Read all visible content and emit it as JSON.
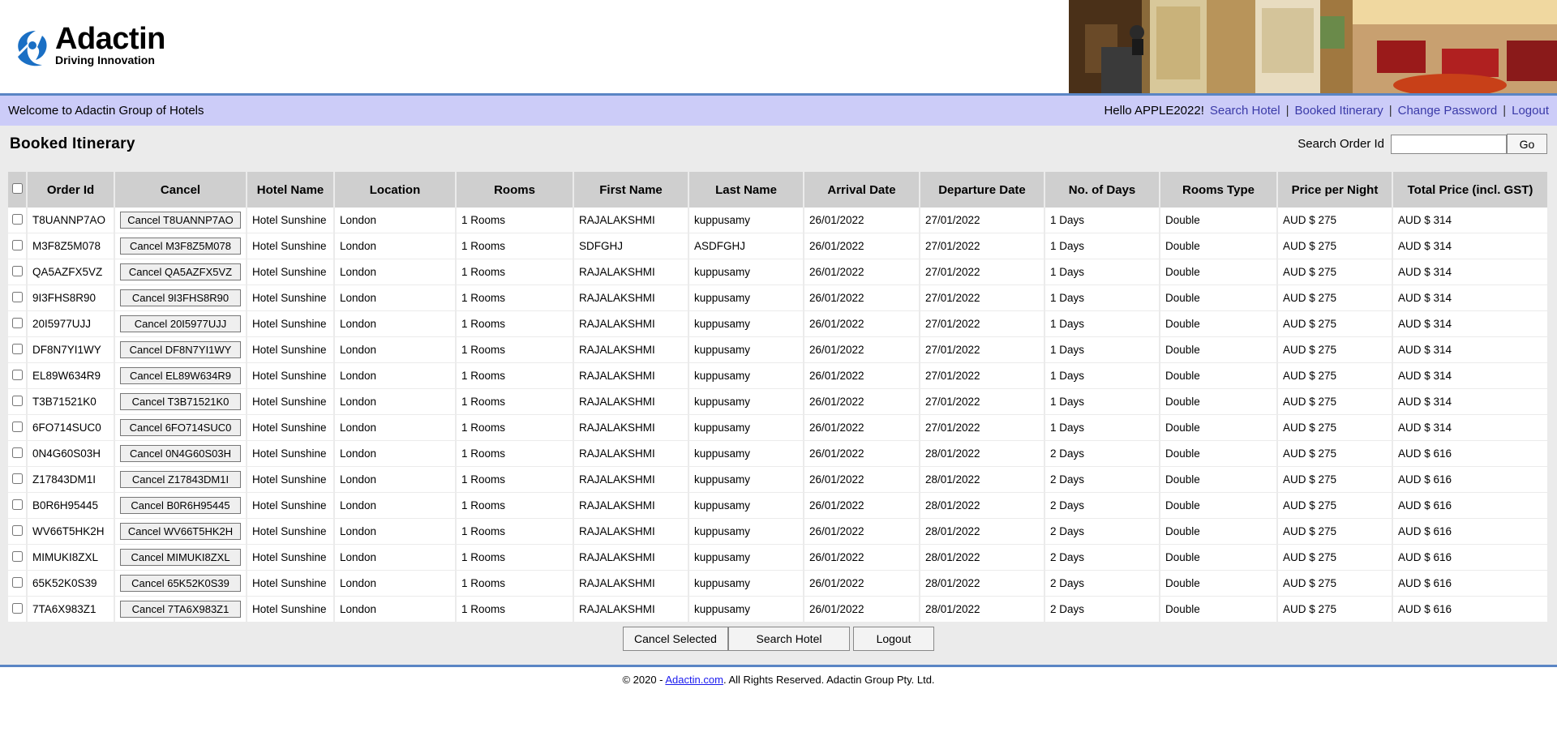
{
  "logo": {
    "word": "Adactin",
    "tagline": "Driving Innovation"
  },
  "navbar": {
    "welcome": "Welcome to Adactin Group of Hotels",
    "hello": "Hello APPLE2022!",
    "links": [
      "Search Hotel",
      "Booked Itinerary",
      "Change Password",
      "Logout"
    ]
  },
  "page": {
    "title": "Booked Itinerary",
    "search_label": "Search Order Id",
    "search_value": "",
    "go_label": "Go"
  },
  "table": {
    "headers": [
      "Order Id",
      "Cancel",
      "Hotel Name",
      "Location",
      "Rooms",
      "First Name",
      "Last Name",
      "Arrival Date",
      "Departure Date",
      "No. of Days",
      "Rooms Type",
      "Price per Night",
      "Total Price (incl. GST)"
    ],
    "rows": [
      [
        "T8UANNP7AO",
        "Cancel T8UANNP7AO",
        "Hotel Sunshine",
        "London",
        "1 Rooms",
        "RAJALAKSHMI",
        "kuppusamy",
        "26/01/2022",
        "27/01/2022",
        "1 Days",
        "Double",
        "AUD $ 275",
        "AUD $ 314"
      ],
      [
        "M3F8Z5M078",
        "Cancel M3F8Z5M078",
        "Hotel Sunshine",
        "London",
        "1 Rooms",
        "SDFGHJ",
        "ASDFGHJ",
        "26/01/2022",
        "27/01/2022",
        "1 Days",
        "Double",
        "AUD $ 275",
        "AUD $ 314"
      ],
      [
        "QA5AZFX5VZ",
        "Cancel QA5AZFX5VZ",
        "Hotel Sunshine",
        "London",
        "1 Rooms",
        "RAJALAKSHMI",
        "kuppusamy",
        "26/01/2022",
        "27/01/2022",
        "1 Days",
        "Double",
        "AUD $ 275",
        "AUD $ 314"
      ],
      [
        "9I3FHS8R90",
        "Cancel 9I3FHS8R90",
        "Hotel Sunshine",
        "London",
        "1 Rooms",
        "RAJALAKSHMI",
        "kuppusamy",
        "26/01/2022",
        "27/01/2022",
        "1 Days",
        "Double",
        "AUD $ 275",
        "AUD $ 314"
      ],
      [
        "20I5977UJJ",
        "Cancel 20I5977UJJ",
        "Hotel Sunshine",
        "London",
        "1 Rooms",
        "RAJALAKSHMI",
        "kuppusamy",
        "26/01/2022",
        "27/01/2022",
        "1 Days",
        "Double",
        "AUD $ 275",
        "AUD $ 314"
      ],
      [
        "DF8N7YI1WY",
        "Cancel DF8N7YI1WY",
        "Hotel Sunshine",
        "London",
        "1 Rooms",
        "RAJALAKSHMI",
        "kuppusamy",
        "26/01/2022",
        "27/01/2022",
        "1 Days",
        "Double",
        "AUD $ 275",
        "AUD $ 314"
      ],
      [
        "EL89W634R9",
        "Cancel EL89W634R9",
        "Hotel Sunshine",
        "London",
        "1 Rooms",
        "RAJALAKSHMI",
        "kuppusamy",
        "26/01/2022",
        "27/01/2022",
        "1 Days",
        "Double",
        "AUD $ 275",
        "AUD $ 314"
      ],
      [
        "T3B71521K0",
        "Cancel T3B71521K0",
        "Hotel Sunshine",
        "London",
        "1 Rooms",
        "RAJALAKSHMI",
        "kuppusamy",
        "26/01/2022",
        "27/01/2022",
        "1 Days",
        "Double",
        "AUD $ 275",
        "AUD $ 314"
      ],
      [
        "6FO714SUC0",
        "Cancel 6FO714SUC0",
        "Hotel Sunshine",
        "London",
        "1 Rooms",
        "RAJALAKSHMI",
        "kuppusamy",
        "26/01/2022",
        "27/01/2022",
        "1 Days",
        "Double",
        "AUD $ 275",
        "AUD $ 314"
      ],
      [
        "0N4G60S03H",
        "Cancel 0N4G60S03H",
        "Hotel Sunshine",
        "London",
        "1 Rooms",
        "RAJALAKSHMI",
        "kuppusamy",
        "26/01/2022",
        "28/01/2022",
        "2 Days",
        "Double",
        "AUD $ 275",
        "AUD $ 616"
      ],
      [
        "Z17843DM1I",
        "Cancel Z17843DM1I",
        "Hotel Sunshine",
        "London",
        "1 Rooms",
        "RAJALAKSHMI",
        "kuppusamy",
        "26/01/2022",
        "28/01/2022",
        "2 Days",
        "Double",
        "AUD $ 275",
        "AUD $ 616"
      ],
      [
        "B0R6H95445",
        "Cancel B0R6H95445",
        "Hotel Sunshine",
        "London",
        "1 Rooms",
        "RAJALAKSHMI",
        "kuppusamy",
        "26/01/2022",
        "28/01/2022",
        "2 Days",
        "Double",
        "AUD $ 275",
        "AUD $ 616"
      ],
      [
        "WV66T5HK2H",
        "Cancel WV66T5HK2H",
        "Hotel Sunshine",
        "London",
        "1 Rooms",
        "RAJALAKSHMI",
        "kuppusamy",
        "26/01/2022",
        "28/01/2022",
        "2 Days",
        "Double",
        "AUD $ 275",
        "AUD $ 616"
      ],
      [
        "MIMUKI8ZXL",
        "Cancel MIMUKI8ZXL",
        "Hotel Sunshine",
        "London",
        "1 Rooms",
        "RAJALAKSHMI",
        "kuppusamy",
        "26/01/2022",
        "28/01/2022",
        "2 Days",
        "Double",
        "AUD $ 275",
        "AUD $ 616"
      ],
      [
        "65K52K0S39",
        "Cancel 65K52K0S39",
        "Hotel Sunshine",
        "London",
        "1 Rooms",
        "RAJALAKSHMI",
        "kuppusamy",
        "26/01/2022",
        "28/01/2022",
        "2 Days",
        "Double",
        "AUD $ 275",
        "AUD $ 616"
      ],
      [
        "7TA6X983Z1",
        "Cancel 7TA6X983Z1",
        "Hotel Sunshine",
        "London",
        "1 Rooms",
        "RAJALAKSHMI",
        "kuppusamy",
        "26/01/2022",
        "28/01/2022",
        "2 Days",
        "Double",
        "AUD $ 275",
        "AUD $ 616"
      ]
    ]
  },
  "actions": {
    "cancel_selected": "Cancel Selected",
    "search_hotel": "Search Hotel",
    "logout": "Logout"
  },
  "footer": {
    "prefix": "© 2020 - ",
    "link": "Adactin.com",
    "suffix": ". All Rights Reserved. Adactin Group Pty. Ltd."
  },
  "colors": {
    "navbar_bg": "#ccccf8",
    "link": "#3a3aa8",
    "header_rule": "#5a85c4",
    "logo_blue": "#1a6fc4"
  }
}
